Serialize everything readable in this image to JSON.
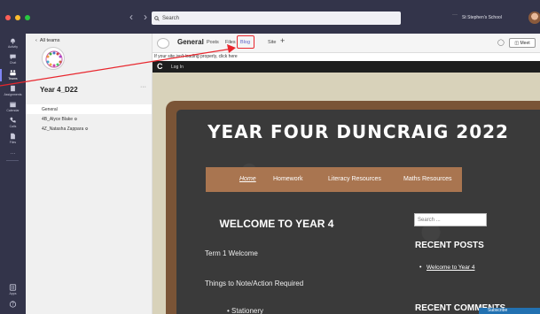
{
  "titlebar": {
    "search_placeholder": "Search",
    "more": "···",
    "school": "St Stephen's School"
  },
  "rail": [
    {
      "label": "Activity",
      "icon": "bell-icon"
    },
    {
      "label": "Chat",
      "icon": "chat-icon"
    },
    {
      "label": "Teams",
      "icon": "teams-icon"
    },
    {
      "label": "Assignments",
      "icon": "assignments-icon"
    },
    {
      "label": "Calendar",
      "icon": "calendar-icon"
    },
    {
      "label": "Calls",
      "icon": "phone-icon"
    },
    {
      "label": "Files",
      "icon": "file-icon"
    },
    {
      "label": "···",
      "icon": "more-icon"
    },
    {
      "label": "Apps",
      "icon": "apps-icon"
    },
    {
      "label": "Help",
      "icon": "help-icon"
    }
  ],
  "teampanel": {
    "back_label": "All teams",
    "team_name": "Year 4_D22",
    "more": "···",
    "channels": [
      {
        "label": "General"
      },
      {
        "label": "4B_Alyce Blake"
      },
      {
        "label": "4Z_Natasha Zappara"
      }
    ]
  },
  "channel_header": {
    "title": "General",
    "tabs": [
      "Posts",
      "Files",
      "Blog",
      "Site"
    ],
    "add": "+",
    "meet_label": "Meet"
  },
  "notice": "If your site isn't loading properly, click here",
  "blogbar": {
    "logo": "C",
    "login": "Log In"
  },
  "blog": {
    "title": "YEAR FOUR DUNCRAIG 2022",
    "menu": [
      "Home",
      "Homework",
      "Literacy Resources",
      "Maths Resources"
    ],
    "welcome": "WELCOME TO YEAR 4",
    "posts": [
      "Term 1 Welcome",
      "Things to Note/Action Required",
      "• Stationery"
    ],
    "search_placeholder": "Search ...",
    "recent_posts_heading": "RECENT POSTS",
    "recent_posts": [
      "Welcome to Year 4"
    ],
    "recent_comments_heading": "RECENT COMMENTS",
    "subscribe": "Subscribe"
  },
  "colors": {
    "rail": "#33344a",
    "accent": "#5b5fc7",
    "highlight": "#e8262d",
    "chalkboard": "#3a3a3a",
    "frame": "#7a5436",
    "menu": "#a97550"
  }
}
